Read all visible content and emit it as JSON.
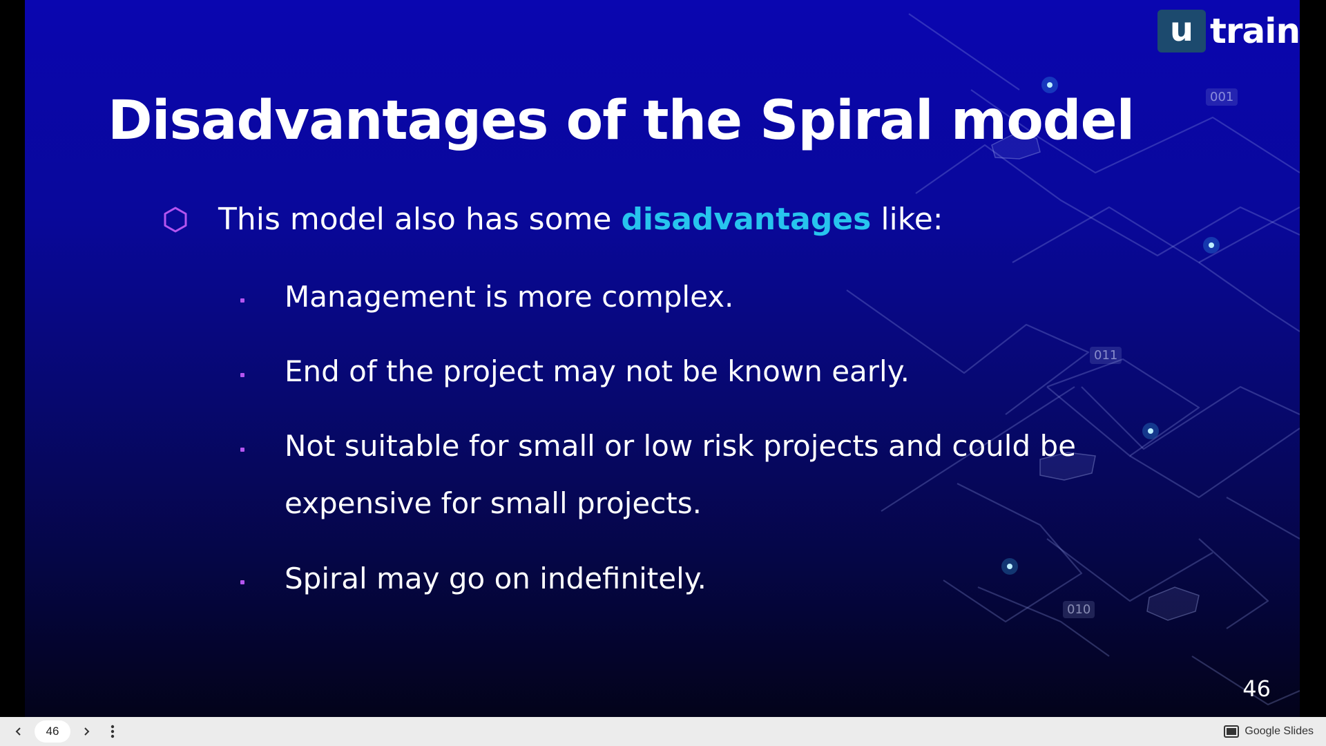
{
  "slide": {
    "logo": {
      "box_letter": "u",
      "word": "train"
    },
    "title": "Disadvantages of the Spiral model",
    "intro": {
      "prefix": "This model also has some ",
      "highlight": "disadvantages",
      "suffix": " like:"
    },
    "bullets": [
      "Management is more complex.",
      "End of the project may not be known early.",
      "Not suitable for small or low risk projects and could be expensive for small projects.",
      "Spiral may go on indefinitely."
    ],
    "page_number": "46",
    "code_tags": [
      "001",
      "011",
      "010"
    ],
    "colors": {
      "highlight": "#27c4ee",
      "bullet": "#b455f0",
      "background_top": "#0a06b0",
      "background_bottom": "#03031a"
    }
  },
  "viewer": {
    "page_input_value": "46",
    "prev_icon": "chevron-left-icon",
    "next_icon": "chevron-right-icon",
    "menu_icon": "more-vert-icon",
    "brand_label": "Google Slides"
  }
}
